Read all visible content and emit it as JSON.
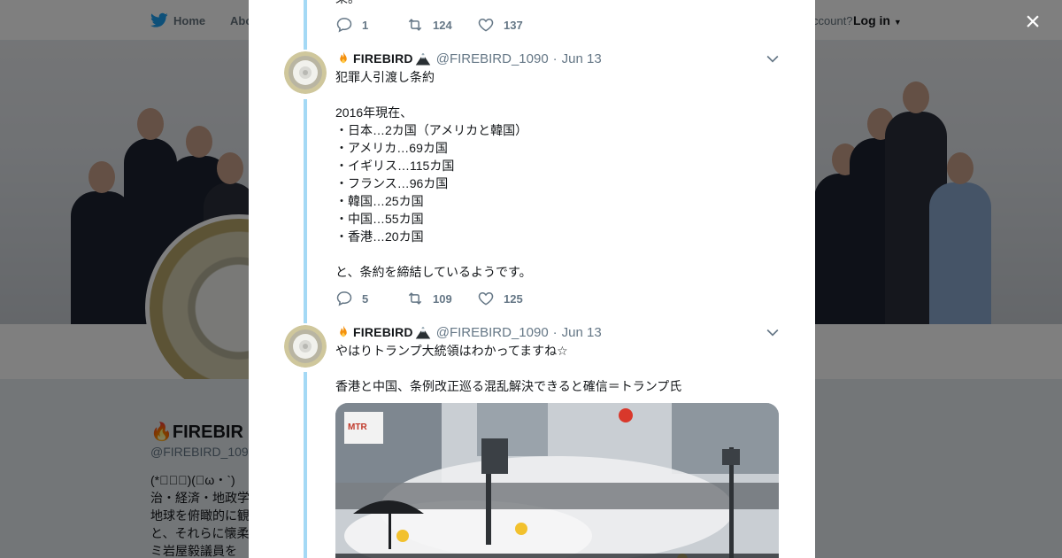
{
  "background": {
    "nav": {
      "home": "Home",
      "about": "Abo",
      "account_prompt": "ccount?",
      "login": "Log in"
    },
    "profile": {
      "name": "FIREBIR",
      "handle": "@FIREBIRD_109",
      "bio_text": "(*ﾟ∀ﾟ)(・ω・`)\n治・経済・地政学\n地球を俯瞰的に観\nと、それらに懐柔\nミ岩屋毅議員を"
    }
  },
  "modal": {
    "close_label": "×",
    "prev_tweet": {
      "text_tail": "果。",
      "replies": "1",
      "retweets": "124",
      "likes": "137"
    },
    "tweets": [
      {
        "display_name": "FIREBIRD",
        "handle": "@FIREBIRD_1090",
        "separator": "·",
        "date": "Jun 13",
        "text": "犯罪人引渡し条約\n\n2016年現在、\n・日本…2カ国（アメリカと韓国）\n・アメリカ…69カ国\n・イギリス…115カ国\n・フランス…96カ国\n・韓国…25カ国\n・中国…55カ国\n・香港…20カ国\n\nと、条約を締結しているようです。",
        "replies": "5",
        "retweets": "109",
        "likes": "125"
      },
      {
        "display_name": "FIREBIRD",
        "handle": "@FIREBIRD_1090",
        "separator": "·",
        "date": "Jun 13",
        "text": "やはりトランプ大統領はわかってますね☆\n\n香港と中国、条例改正巡る混乱解決できると確信＝トランプ氏",
        "photo_sign": "MTR"
      }
    ]
  },
  "colors": {
    "accent": "#1da1f2",
    "thread_line": "#a4d9f5",
    "text_primary": "#14171a",
    "text_secondary": "#657786"
  }
}
